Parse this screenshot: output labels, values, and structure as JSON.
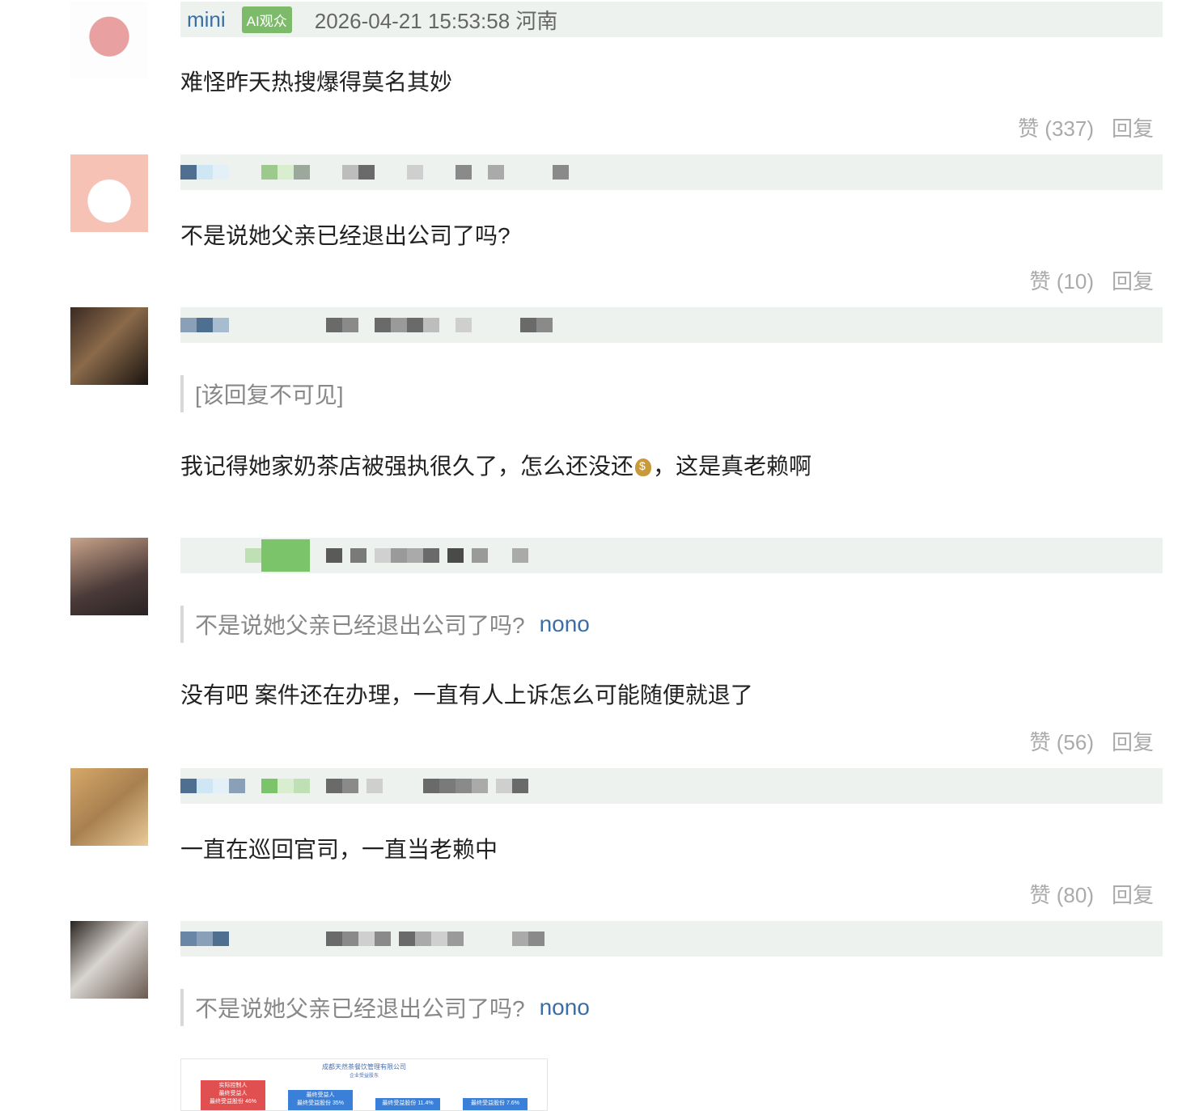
{
  "comments": [
    {
      "user": "mini",
      "badge": "AI观众",
      "time_location": "2026-04-21 15:53:58 河南",
      "text": "难怪昨天热搜爆得莫名其妙",
      "like_label": "赞 (337)",
      "reply_label": "回复"
    },
    {
      "text": "不是说她父亲已经退出公司了吗?",
      "like_label": "赞 (10)",
      "reply_label": "回复"
    },
    {
      "quote": "[该回复不可见]",
      "text_before": "我记得她家奶茶店被强执很久了，怎么还没还",
      "emoji": "money-bag",
      "text_after": "，这是真老赖啊"
    },
    {
      "quote": "不是说她父亲已经退出公司了吗?",
      "quote_user": "nono",
      "text": "没有吧 案件还在办理，一直有人上诉怎么可能随便就退了",
      "like_label": "赞 (56)",
      "reply_label": "回复"
    },
    {
      "text": "一直在巡回官司，一直当老赖中",
      "like_label": "赞 (80)",
      "reply_label": "回复"
    },
    {
      "quote": "不是说她父亲已经退出公司了吗?",
      "quote_user": "nono"
    }
  ],
  "embed_image": {
    "title": "成都天然茶餐饮管理有限公司",
    "subtitle": "企业受益股东",
    "boxes": [
      {
        "label1": "实际控制人",
        "label2": "最终受益人",
        "label3": "最终受益股份 46%",
        "color": "#e05050"
      },
      {
        "label1": "最终受益人",
        "label2": "最终受益股份 35%",
        "color": "#3a7fd8"
      },
      {
        "label1": "最终受益股份 11.4%",
        "color": "#3a7fd8"
      },
      {
        "label1": "最终受益股份 7.6%",
        "color": "#3a7fd8"
      }
    ]
  },
  "colors": {
    "username": "#3b6ea5",
    "badge": "#7dbb6a",
    "meta_bar": "#eef2ee",
    "actions": "#aaaaaa"
  }
}
